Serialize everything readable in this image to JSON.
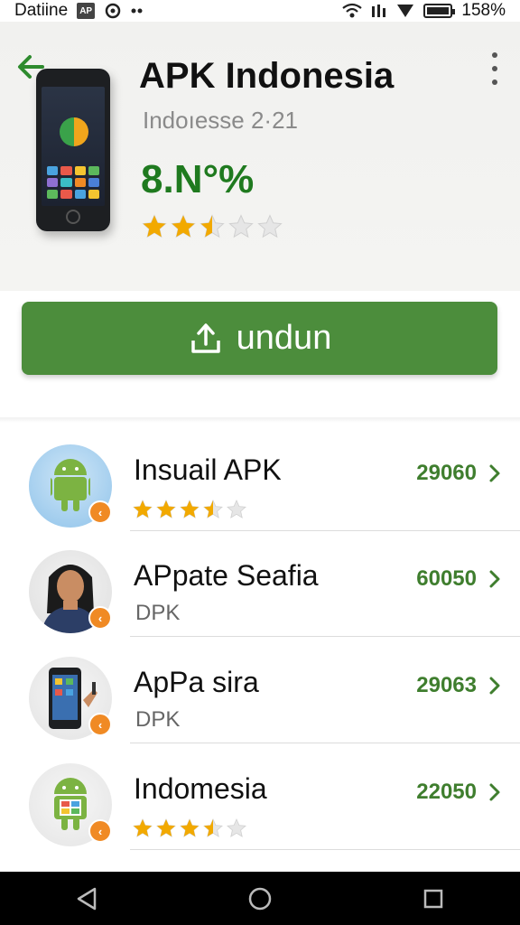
{
  "status_bar": {
    "carrier": "Datiine",
    "box_label": "AP",
    "battery": "158%"
  },
  "app": {
    "title": "APK Indonesia",
    "subtitle": "Indoıesse 2·21",
    "rating": "8.N°%",
    "stars": 2.5
  },
  "download": {
    "label": "undun"
  },
  "list": [
    {
      "title": "Insuail APK",
      "sub": "",
      "stars": 3.5,
      "count": "29060"
    },
    {
      "title": "APpate Seafia",
      "sub": "DPK",
      "stars": null,
      "count": "60050"
    },
    {
      "title": "ApPa sira",
      "sub": "DPK",
      "stars": null,
      "count": "29063"
    },
    {
      "title": "Indomesia",
      "sub": "",
      "stars": 3.5,
      "count": "22050"
    }
  ],
  "colors": {
    "accent_green": "#4c8d3c",
    "rating_green": "#1f7a1f",
    "star_gold": "#f2a900",
    "badge_orange": "#f08a24"
  }
}
